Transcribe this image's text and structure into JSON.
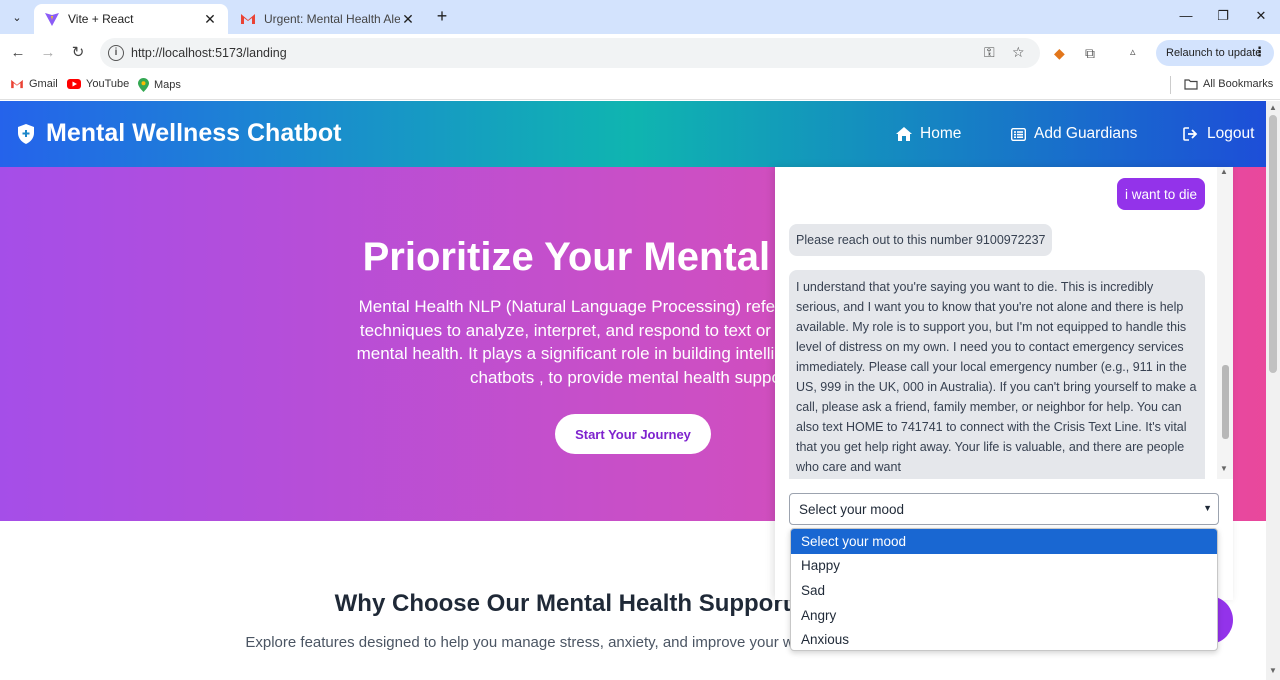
{
  "browser": {
    "tabs": [
      {
        "title": "Vite + React",
        "icon": "vite-icon",
        "active": true
      },
      {
        "title": "Urgent: Mental Health Alert - ra",
        "icon": "gmail-icon",
        "active": false
      }
    ],
    "url": "http://localhost:5173/landing",
    "relaunch_label": "Relaunch to update",
    "bookmarks": [
      {
        "label": "Gmail",
        "icon": "gmail-icon"
      },
      {
        "label": "YouTube",
        "icon": "youtube-icon"
      },
      {
        "label": "Maps",
        "icon": "maps-icon"
      }
    ],
    "all_bookmarks_label": "All Bookmarks"
  },
  "app": {
    "brand": "Mental Wellness Chatbot",
    "nav": [
      {
        "label": "Home",
        "icon": "home-icon"
      },
      {
        "label": "Add Guardians",
        "icon": "list-icon"
      },
      {
        "label": "Logout",
        "icon": "logout-icon"
      }
    ]
  },
  "hero": {
    "title": "Prioritize Your Mental Health",
    "text": "Mental Health NLP (Natural Language Processing) refers to the use of AI techniques to analyze, interpret, and respond to text or speech related to mental health. It plays a significant role in building intelligent systems, like chatbots , to provide mental health support.",
    "button": "Start Your Journey"
  },
  "features": {
    "title": "Why Choose Our Mental Health Support?",
    "subtitle": "Explore features designed to help you manage stress, anxiety, and improve your well-being."
  },
  "chat": {
    "user_message": "i want to die",
    "bot_message_1": "Please reach out to this number 9100972237",
    "bot_message_2": "I understand that you're saying you want to die. This is incredibly serious, and I want you to know that you're not alone and there is help available. My role is to support you, but I'm not equipped to handle this level of distress on my own. I need you to contact emergency services immediately. Please call your local emergency number (e.g., 911 in the US, 999 in the UK, 000 in Australia). If you can't bring yourself to make a call, please ask a friend, family member, or neighbor for help. You can also text HOME to 741741 to connect with the Crisis Text Line. It's vital that you get help right away. Your life is valuable, and there are people who care and want",
    "mood_selected": "Select your mood",
    "mood_options": [
      "Select your mood",
      "Happy",
      "Sad",
      "Angry",
      "Anxious"
    ]
  },
  "colors": {
    "accent": "#9333ea",
    "nav_gradient_start": "#2563eb",
    "nav_gradient_mid": "#0fb5b0",
    "hero_gradient_start": "#a54ee8",
    "hero_gradient_end": "#e9489c",
    "dropdown_highlight": "#1967d2"
  }
}
